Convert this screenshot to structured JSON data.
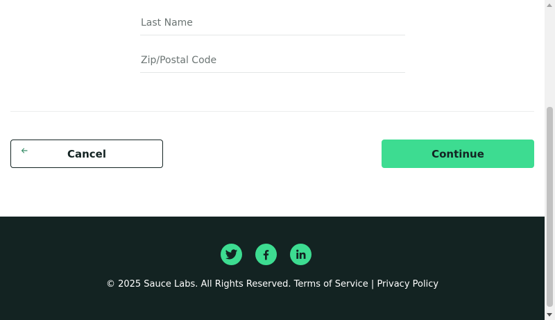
{
  "form": {
    "last_name_placeholder": "Last Name",
    "zip_placeholder": "Zip/Postal Code"
  },
  "actions": {
    "cancel_label": "Cancel",
    "continue_label": "Continue"
  },
  "footer": {
    "social": [
      "twitter",
      "facebook",
      "linkedin"
    ],
    "copyright": "© 2025 Sauce Labs. All Rights Reserved. Terms of Service | Privacy Policy"
  },
  "colors": {
    "accent": "#3ddc91",
    "footer_bg": "#132322",
    "text": "#132322"
  }
}
